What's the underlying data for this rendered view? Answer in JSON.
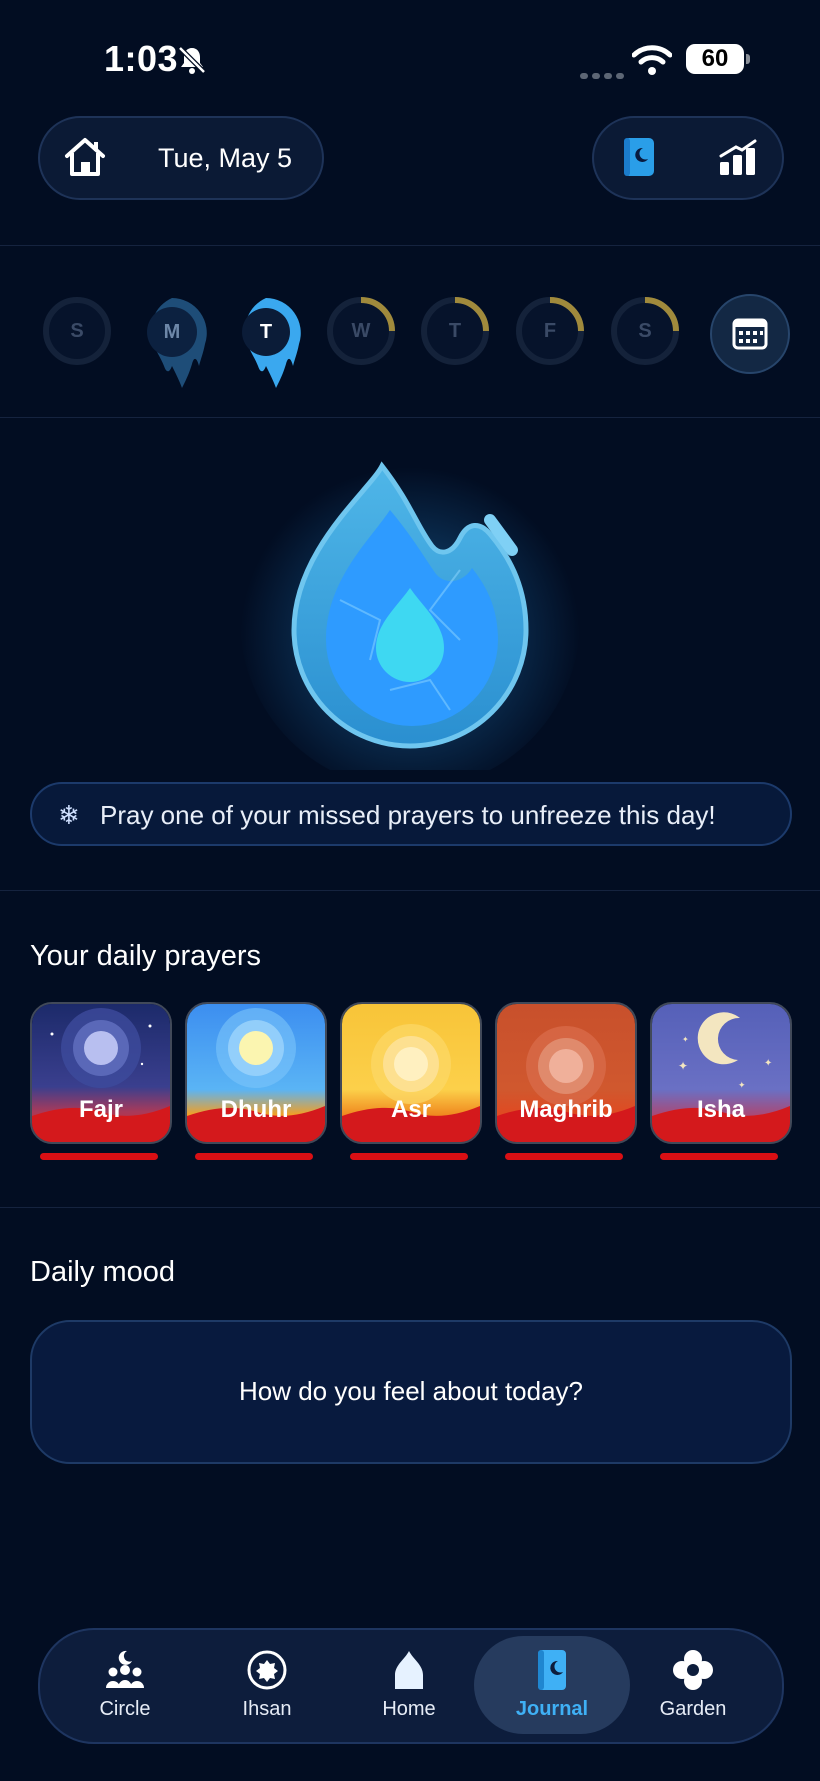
{
  "status_bar": {
    "time": "1:03",
    "battery": "60"
  },
  "header": {
    "date": "Tue, May 5"
  },
  "week": {
    "days": [
      {
        "label": "S",
        "state": "empty"
      },
      {
        "label": "M",
        "state": "frozen"
      },
      {
        "label": "T",
        "state": "frozen-selected"
      },
      {
        "label": "W",
        "state": "partial"
      },
      {
        "label": "T",
        "state": "partial"
      },
      {
        "label": "F",
        "state": "partial"
      },
      {
        "label": "S",
        "state": "partial"
      }
    ]
  },
  "banner": {
    "text": "Pray one of your missed prayers to unfreeze this day!"
  },
  "prayers": {
    "title": "Your daily prayers",
    "items": [
      {
        "name": "Fajr",
        "status_color": "#d90f14"
      },
      {
        "name": "Dhuhr",
        "status_color": "#d90f14"
      },
      {
        "name": "Asr",
        "status_color": "#d90f14"
      },
      {
        "name": "Maghrib",
        "status_color": "#d90f14"
      },
      {
        "name": "Isha",
        "status_color": "#d90f14"
      }
    ]
  },
  "mood": {
    "title": "Daily mood",
    "prompt": "How do you feel about today?"
  },
  "nav": {
    "items": [
      {
        "label": "Circle",
        "icon": "circle-group-icon"
      },
      {
        "label": "Ihsan",
        "icon": "ihsan-icon"
      },
      {
        "label": "Home",
        "icon": "home-dome-icon"
      },
      {
        "label": "Journal",
        "icon": "journal-icon",
        "active": true
      },
      {
        "label": "Garden",
        "icon": "flower-icon"
      }
    ]
  },
  "colors": {
    "accent": "#3fb0f5",
    "background": "#020d22",
    "missed": "#d90f14",
    "partial_ring": "#a08a3c"
  }
}
